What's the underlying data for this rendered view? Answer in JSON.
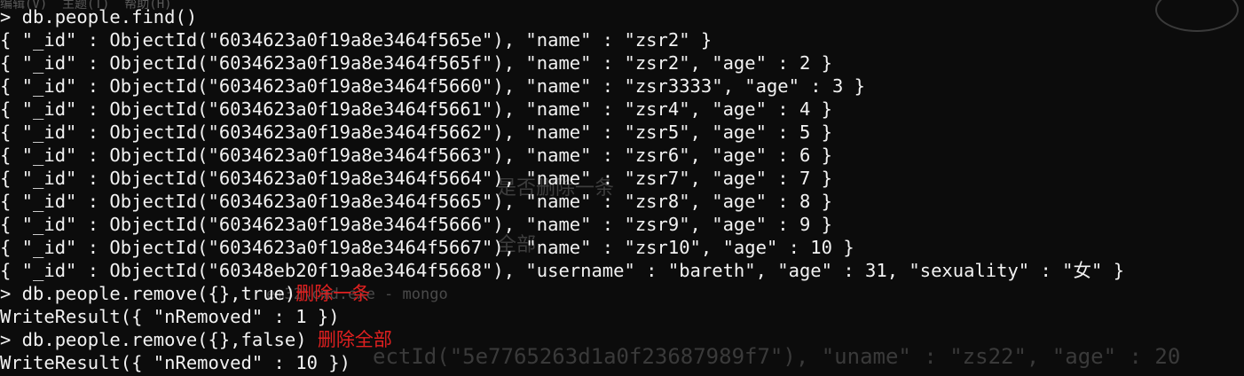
{
  "terminal": {
    "background_color": "#0c0c0c",
    "text_color": "#f2f2f2",
    "annotation_color": "#e02020",
    "lines": [
      "> db.people.find()",
      "{ \"_id\" : ObjectId(\"6034623a0f19a8e3464f565e\"), \"name\" : \"zsr2\" }",
      "{ \"_id\" : ObjectId(\"6034623a0f19a8e3464f565f\"), \"name\" : \"zsr2\", \"age\" : 2 }",
      "{ \"_id\" : ObjectId(\"6034623a0f19a8e3464f5660\"), \"name\" : \"zsr3333\", \"age\" : 3 }",
      "{ \"_id\" : ObjectId(\"6034623a0f19a8e3464f5661\"), \"name\" : \"zsr4\", \"age\" : 4 }",
      "{ \"_id\" : ObjectId(\"6034623a0f19a8e3464f5662\"), \"name\" : \"zsr5\", \"age\" : 5 }",
      "{ \"_id\" : ObjectId(\"6034623a0f19a8e3464f5663\"), \"name\" : \"zsr6\", \"age\" : 6 }",
      "{ \"_id\" : ObjectId(\"6034623a0f19a8e3464f5664\"), \"name\" : \"zsr7\", \"age\" : 7 }",
      "{ \"_id\" : ObjectId(\"6034623a0f19a8e3464f5665\"), \"name\" : \"zsr8\", \"age\" : 8 }",
      "{ \"_id\" : ObjectId(\"6034623a0f19a8e3464f5666\"), \"name\" : \"zsr9\", \"age\" : 9 }",
      "{ \"_id\" : ObjectId(\"6034623a0f19a8e3464f5667\"), \"name\" : \"zsr10\", \"age\" : 10 }",
      "{ \"_id\" : ObjectId(\"60348eb20f19a8e3464f5668\"), \"username\" : \"bareth\", \"age\" : 31, \"sexuality\" : \"女\" }",
      "> db.people.remove({},true)",
      "WriteResult({ \"nRemoved\" : 1 })",
      "> db.people.remove({},false) ",
      "WriteResult({ \"nRemoved\" : 10 })"
    ],
    "annotations": {
      "remove_one": "删除一条",
      "remove_all": "删除全部"
    }
  },
  "background_ghost": {
    "menu": "编辑(V)  主题(T)  帮助(H)",
    "overlay_1": "是否删除一条",
    "overlay_2": "全部",
    "window_title": "em32\\cmd.exe - mongo",
    "bottom_text": "ectId(\"5e7765263d1a0f23687989f7\"), \"uname\" : \"zs22\", \"age\" : 20"
  }
}
